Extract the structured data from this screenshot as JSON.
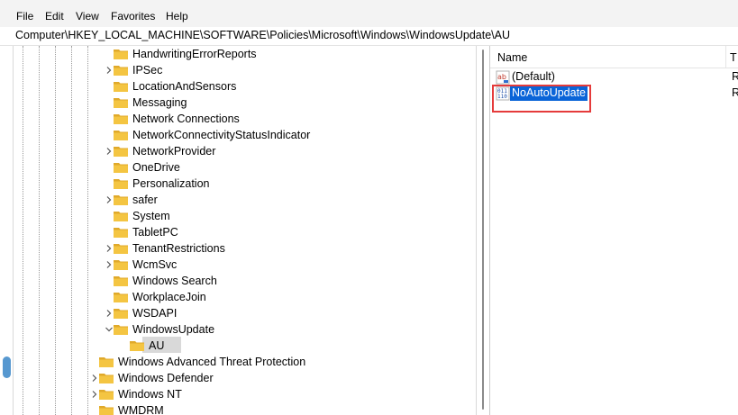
{
  "menu": [
    "File",
    "Edit",
    "View",
    "Favorites",
    "Help"
  ],
  "address": "Computer\\HKEY_LOCAL_MACHINE\\SOFTWARE\\Policies\\Microsoft\\Windows\\WindowsUpdate\\AU",
  "tree": {
    "items": [
      {
        "label": "HandwritingErrorReports",
        "expander": ""
      },
      {
        "label": "IPSec",
        "expander": "collapsed"
      },
      {
        "label": "LocationAndSensors",
        "expander": ""
      },
      {
        "label": "Messaging",
        "expander": ""
      },
      {
        "label": "Network Connections",
        "expander": ""
      },
      {
        "label": "NetworkConnectivityStatusIndicator",
        "expander": ""
      },
      {
        "label": "NetworkProvider",
        "expander": "collapsed"
      },
      {
        "label": "OneDrive",
        "expander": ""
      },
      {
        "label": "Personalization",
        "expander": ""
      },
      {
        "label": "safer",
        "expander": "collapsed"
      },
      {
        "label": "System",
        "expander": ""
      },
      {
        "label": "TabletPC",
        "expander": ""
      },
      {
        "label": "TenantRestrictions",
        "expander": "collapsed"
      },
      {
        "label": "WcmSvc",
        "expander": "collapsed"
      },
      {
        "label": "Windows Search",
        "expander": ""
      },
      {
        "label": "WorkplaceJoin",
        "expander": ""
      },
      {
        "label": "WSDAPI",
        "expander": "collapsed"
      },
      {
        "label": "WindowsUpdate",
        "expander": "expanded"
      },
      {
        "label": "AU",
        "expander": "",
        "selected": true
      },
      {
        "label": "Windows Advanced Threat Protection",
        "expander": ""
      },
      {
        "label": "Windows Defender",
        "expander": "collapsed"
      },
      {
        "label": "Windows NT",
        "expander": "collapsed"
      },
      {
        "label": "WMDRM",
        "expander": ""
      }
    ]
  },
  "values_pane": {
    "columns": [
      "Name",
      "T"
    ],
    "rows": [
      {
        "name": "(Default)",
        "type": "R",
        "icon": "string-value-icon"
      },
      {
        "name": "NoAutoUpdate",
        "type": "R",
        "icon": "dword-value-icon",
        "selected": true
      }
    ]
  },
  "colors": {
    "folder": "#f4c542",
    "selection": "#0a64d8",
    "highlight_box": "#e53b3b"
  }
}
